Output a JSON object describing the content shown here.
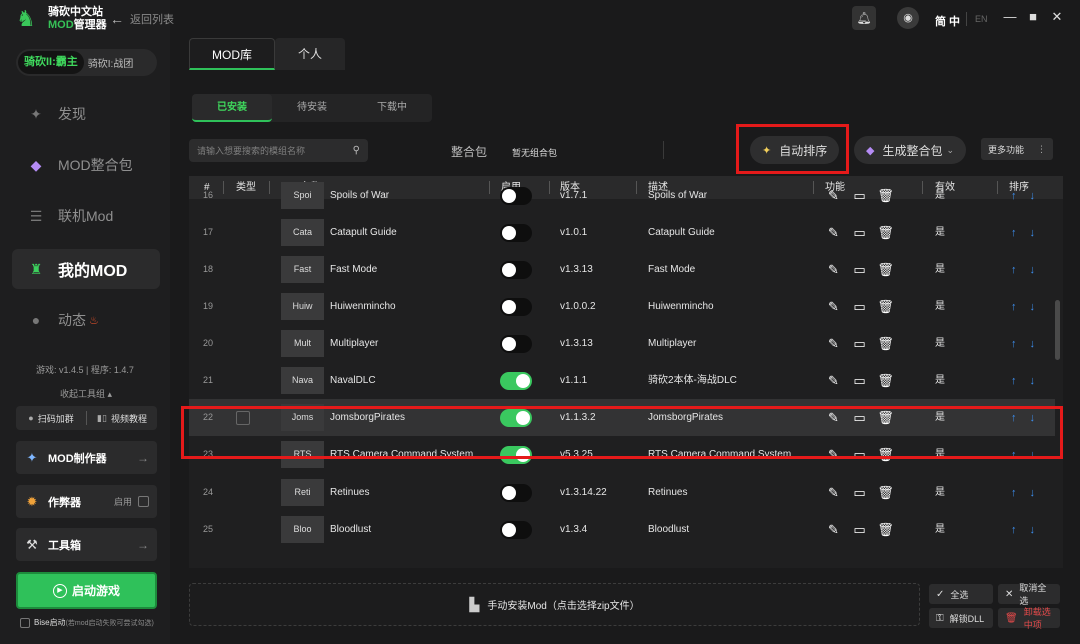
{
  "app": {
    "logo_line1": "骑砍中文站",
    "logo_line2_a": "MOD",
    "logo_line2_b": "管理器",
    "back_label": "返回列表"
  },
  "titlebar": {
    "lang_active": "简 中",
    "lang_inactive": "EN"
  },
  "sidebar": {
    "game_active": "骑砍II:霸主",
    "game_inactive": "骑砍I:战团",
    "nav": [
      {
        "label": "发现",
        "icon": "discover-icon"
      },
      {
        "label": "MOD整合包",
        "icon": "diamond-icon"
      },
      {
        "label": "联机Mod",
        "icon": "server-icon"
      },
      {
        "label": "我的MOD",
        "icon": "my-mod-icon"
      },
      {
        "label": "动态",
        "icon": "chat-icon"
      }
    ],
    "version_text": "游戏: v1.4.5 | 程序: 1.4.7",
    "collapse_text": "收起工具组 ▴",
    "qr_label": "扫码加群",
    "video_label": "视频教程",
    "mod_maker": "MOD制作器",
    "cheater": "作弊器",
    "cheater_enable": "启用",
    "toolbox": "工具箱",
    "start_game": "启动游戏",
    "bise_label": "Bise启动",
    "bise_hint": "(若mod启动失败可尝试勾选)"
  },
  "main": {
    "tabs": [
      "MOD库",
      "个人"
    ],
    "subtabs": [
      "已安装",
      "待安装",
      "下载中"
    ],
    "search_placeholder": "请输入想要搜索的模组名称",
    "pack_label": "整合包",
    "pack_value": "暂无组合包",
    "auto_sort": "自动排序",
    "gen_pack": "生成整合包",
    "more_func": "更多功能"
  },
  "table": {
    "headers": {
      "idx": "#",
      "type": "类型",
      "name": "Mod名称",
      "enable": "启用",
      "version": "版本",
      "desc": "描述",
      "func": "功能",
      "effective": "有效",
      "sort": "排序"
    },
    "rows": [
      {
        "idx": "16",
        "thumb": "Spoi",
        "name": "Spoils of War",
        "enabled": false,
        "version": "v1.7.1",
        "desc": "Spoils of War",
        "effective": "是"
      },
      {
        "idx": "17",
        "thumb": "Cata",
        "name": "Catapult Guide",
        "enabled": false,
        "version": "v1.0.1",
        "desc": "Catapult Guide",
        "effective": "是"
      },
      {
        "idx": "18",
        "thumb": "Fast",
        "name": "Fast Mode",
        "enabled": false,
        "version": "v1.3.13",
        "desc": "Fast Mode",
        "effective": "是"
      },
      {
        "idx": "19",
        "thumb": "Huiw",
        "name": "Huiwenmincho",
        "enabled": false,
        "version": "v1.0.0.2",
        "desc": "Huiwenmincho",
        "effective": "是"
      },
      {
        "idx": "20",
        "thumb": "Mult",
        "name": "Multiplayer",
        "enabled": false,
        "version": "v1.3.13",
        "desc": "Multiplayer",
        "effective": "是"
      },
      {
        "idx": "21",
        "thumb": "Nava",
        "name": "NavalDLC",
        "enabled": true,
        "version": "v1.1.1",
        "desc": "骑砍2本体-海战DLC",
        "effective": "是"
      },
      {
        "idx": "22",
        "thumb": "Joms",
        "name": "JomsborgPirates",
        "enabled": true,
        "version": "v1.1.3.2",
        "desc": "JomsborgPirates",
        "effective": "是"
      },
      {
        "idx": "23",
        "thumb": "RTS",
        "name": "RTS Camera Command System",
        "enabled": true,
        "version": "v5.3.25",
        "desc": "RTS Camera Command System",
        "effective": "是"
      },
      {
        "idx": "24",
        "thumb": "Reti",
        "name": "Retinues",
        "enabled": false,
        "version": "v1.3.14.22",
        "desc": "Retinues",
        "effective": "是"
      },
      {
        "idx": "25",
        "thumb": "Bloo",
        "name": "Bloodlust",
        "enabled": false,
        "version": "v1.3.4",
        "desc": "Bloodlust",
        "effective": "是"
      }
    ]
  },
  "bottom": {
    "install_label": "手动安装Mod（点击选择zip文件）",
    "select_all": "全选",
    "deselect_all": "取消全选",
    "unlock_dll": "解锁DLL",
    "remove_selected": "卸载选中项"
  },
  "colors": {
    "accent": "#2fc15a",
    "highlight_box": "#e51a1a",
    "sort_arrow": "#3d8ff0"
  }
}
